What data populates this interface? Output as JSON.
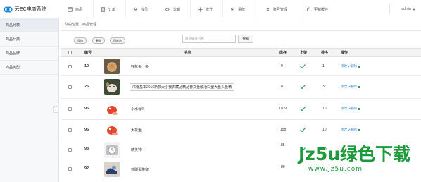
{
  "brand": {
    "name": "云EC电商系统"
  },
  "nav": [
    {
      "label": "商品",
      "icon": "goods-icon"
    },
    {
      "label": "订单",
      "icon": "order-icon"
    },
    {
      "label": "会员",
      "icon": "member-icon"
    },
    {
      "label": "营销",
      "icon": "marketing-icon"
    },
    {
      "label": "统计",
      "icon": "stats-icon"
    },
    {
      "label": "系统",
      "icon": "gear-icon"
    },
    {
      "label": "账号管理",
      "icon": "account-icon"
    },
    {
      "label": "更新缓存",
      "icon": "refresh-icon"
    }
  ],
  "user": {
    "name": "admin"
  },
  "sidebar": {
    "items": [
      {
        "label": "商品列表",
        "active": true
      },
      {
        "label": "商品分类",
        "active": false
      },
      {
        "label": "商品品牌",
        "active": false
      },
      {
        "label": "商品类型",
        "active": false
      }
    ]
  },
  "breadcrumb": {
    "text": "你的位置：商品管理"
  },
  "toolbar": {
    "add": "添加",
    "delete": "删除",
    "recycle": "回收站",
    "search_placeholder": "商品编号名称",
    "search_button": "搜索"
  },
  "table": {
    "headers": {
      "id": "编号",
      "name": "名称",
      "stock": "库存",
      "on_sale": "上架",
      "sort": "排序",
      "ops": "操作"
    },
    "edit_label": "修改",
    "delete_label": "删除",
    "rows": [
      {
        "id": "19",
        "name": "好盆鱼一条",
        "stock": "9",
        "on_sale": true,
        "sort": "1"
      },
      {
        "id": "25",
        "name": "浓缩基本2016新款大小我农藏品精品普文鱼触冶口型大鱼头鱼精",
        "stock": "8",
        "on_sale": true,
        "sort": "3"
      },
      {
        "id": "96",
        "name": "小水母2",
        "stock": "1109",
        "on_sale": true,
        "sort": "10"
      },
      {
        "id": "95",
        "name": "大花鱼",
        "stock": "158",
        "on_sale": true,
        "sort": "10"
      },
      {
        "id": "93",
        "name": "精美钟",
        "stock": "85",
        "on_sale": true,
        "sort": "10"
      },
      {
        "id": "92",
        "name": "蓝脚蛋带窗",
        "stock": "80",
        "on_sale": true,
        "sort": "10"
      }
    ]
  },
  "watermark": {
    "main": "Jz5u绿色下载",
    "sub": "www.Jz5u.com"
  },
  "colors": {
    "accent": "#3a8ad0",
    "check": "#2e9e5e",
    "watermark": "#1c9a3c"
  }
}
